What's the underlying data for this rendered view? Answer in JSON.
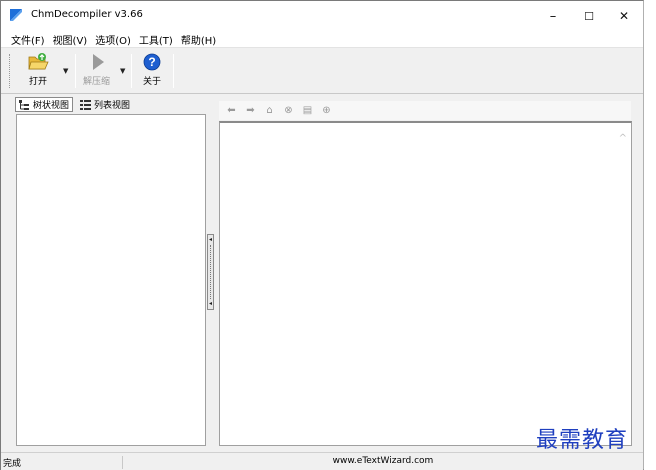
{
  "window": {
    "title": "ChmDecompiler v3.66",
    "controls": {
      "minimize": "–",
      "maximize": "☐",
      "close": "✕"
    }
  },
  "menubar": {
    "items": [
      {
        "label": "文件(F)"
      },
      {
        "label": "视图(V)"
      },
      {
        "label": "选项(O)"
      },
      {
        "label": "工具(T)"
      },
      {
        "label": "帮助(H)"
      }
    ]
  },
  "toolbar": {
    "open_label": "打开",
    "extract_label": "解压缩",
    "about_label": "关于",
    "open_icon": "folder-open-icon",
    "extract_icon": "play-icon",
    "about_icon": "help-icon"
  },
  "left_panel": {
    "tabs": [
      {
        "label": "树状视图",
        "icon": "tree-icon",
        "active": true
      },
      {
        "label": "列表视图",
        "icon": "list-icon",
        "active": false
      }
    ]
  },
  "browser_toolbar": {
    "icons": [
      "back-icon",
      "forward-icon",
      "home-icon",
      "stop-icon",
      "print-icon",
      "zoom-icon"
    ]
  },
  "statusbar": {
    "status": "完成",
    "website": "www.eTextWizard.com"
  },
  "watermark": "最需教育",
  "colors": {
    "accent": "#1e6fd9",
    "watermark": "#1f3fbf",
    "chrome": "#f0f0f0"
  }
}
